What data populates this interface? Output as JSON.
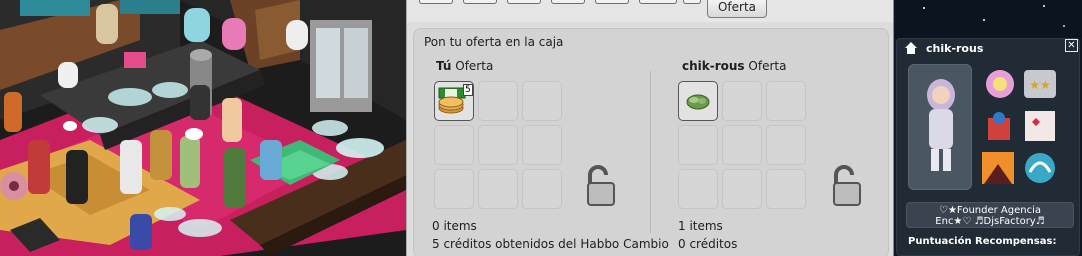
{
  "trade": {
    "offer_button": "Oferta",
    "instruction": "Pon tu oferta en la caja",
    "you": {
      "name": "Tú",
      "suffix": "Oferta",
      "item_count": "0 items",
      "credits": "5 créditos obtenidos del Habbo Cambio",
      "slot_badge": "5"
    },
    "other": {
      "name": "chik-rous",
      "suffix": "Oferta",
      "item_count": "1 items",
      "credits": "0 créditos"
    }
  },
  "profile": {
    "name": "chik-rous",
    "motto_line1": "♡★Founder Agencia",
    "motto_line2": "Enc★♡ ♬DjsFactory♬",
    "rewards_label": "Puntuación Recompensas:"
  },
  "colors": {
    "trade_bg": "#dddddd",
    "panel_bg": "#d3d3d3",
    "profile_bg": "#202b35",
    "floor_pink": "#d0246a"
  }
}
